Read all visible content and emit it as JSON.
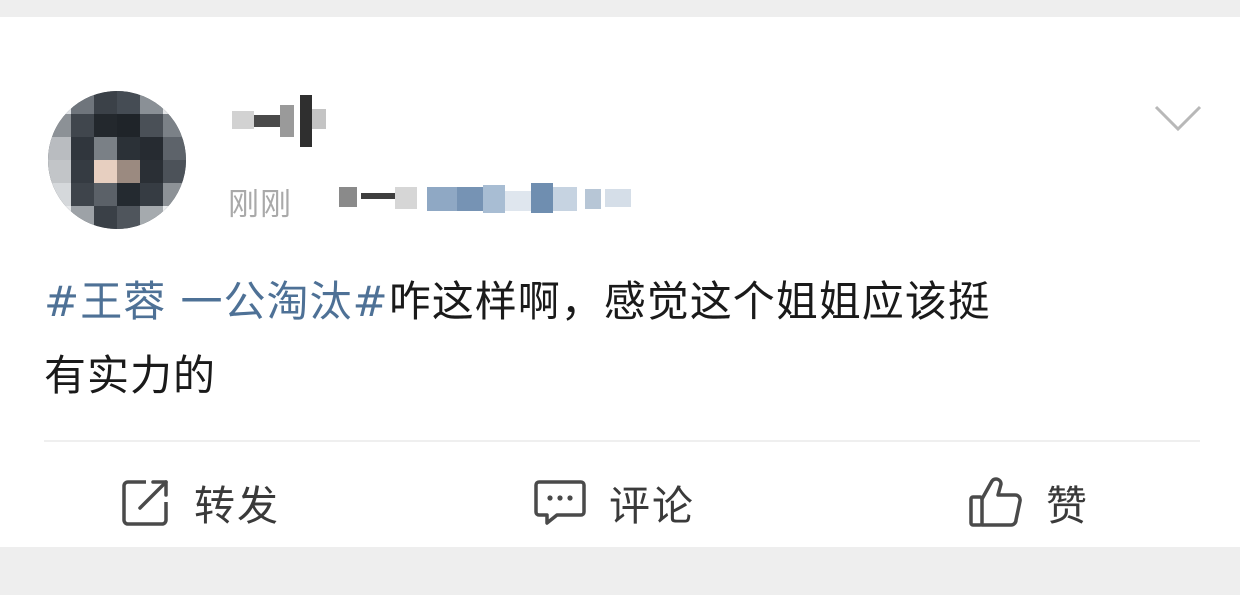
{
  "post": {
    "time": "刚刚",
    "content": {
      "hashtag": "#王蓉 一公淘汰#",
      "text_line1": "咋这样啊，感觉这个姐姐应该挺",
      "text_line2": "有实力的"
    }
  },
  "actions": {
    "repost_label": "转发",
    "comment_label": "评论",
    "like_label": "赞"
  },
  "colors": {
    "hashtag": "#4e7196",
    "body_text": "#1a1a1a",
    "meta_text": "#a9a9a9",
    "page_bg": "#eeeeee",
    "card_bg": "#ffffff"
  },
  "icons": {
    "menu": "chevron-down-icon",
    "repost": "share-icon",
    "comment": "comment-icon",
    "like": "thumbs-up-icon"
  }
}
